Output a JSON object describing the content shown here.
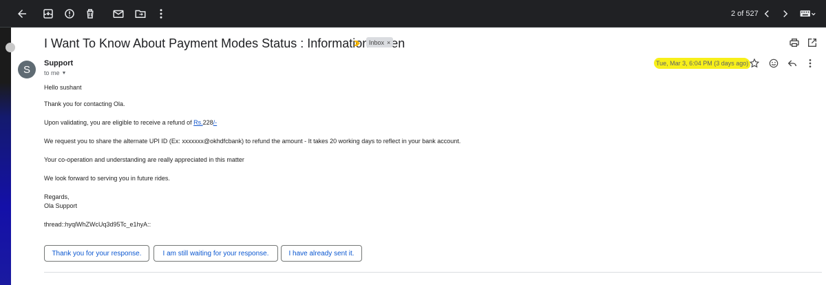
{
  "toolbar": {
    "pagination": "2 of 527",
    "icons": [
      "back-arrow-icon",
      "archive-icon",
      "report-spam-icon",
      "delete-icon",
      "mark-unread-icon",
      "move-to-icon",
      "more-vert-icon",
      "chevron-left-icon",
      "chevron-right-icon",
      "input-tools-icon"
    ]
  },
  "email": {
    "subject": "I Want To Know About Payment Modes Status : Information Given",
    "label_chip": "Inbox",
    "label_chip_close": "×",
    "sender_initial": "S",
    "sender_name": "Support",
    "recipient": "to me",
    "date": "Tue, Mar 3, 6:04 PM (3 days ago)",
    "highlight_color": "#f7ef1a"
  },
  "body": {
    "greeting": "Hello sushant",
    "line1": "Thank you for contacting Ola.",
    "line2_prefix": "Upon validating, you are eligible to receive a refund of ",
    "line2_link": "Rs.",
    "line2_amount": "228",
    "line2_link2": "/-",
    "line3": "We request you to share the alternate UPI ID (Ex: xxxxxxx@okhdfcbank) to refund the amount - It takes 20 working days to reflect in your bank account.",
    "line4": "Your co-operation and understanding are really appreciated in this matter",
    "line5": "We look forward to serving you in future rides.",
    "regards": "Regards,",
    "signature": "Ola Support",
    "thread_id": "thread::hyqlWhZWcUq3d95Tc_e1hyA::"
  },
  "smart_replies": [
    "Thank you for your response.",
    "I am still waiting for your response.",
    "I have already sent it."
  ]
}
